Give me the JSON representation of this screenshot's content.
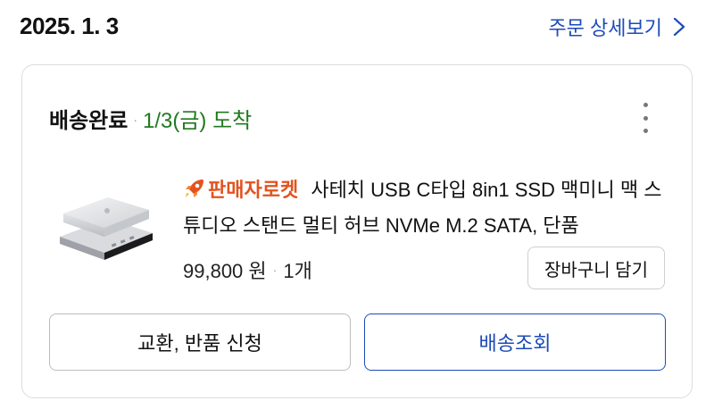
{
  "order": {
    "date": "2025. 1. 3",
    "detail_link_label": "주문 상세보기"
  },
  "status": {
    "main": "배송완료",
    "separator": "·",
    "arrival": "1/3(금) 도착"
  },
  "product": {
    "badge": "판매자로켓",
    "title": "사테치 USB C타입 8in1 SSD 맥미니 맥 스튜디오 스탠드 멀티 허브 NVMe M.2 SATA, 단품",
    "price": "99,800 원",
    "separator": "·",
    "quantity": "1개",
    "cart_button_label": "장바구니 담기"
  },
  "actions": {
    "exchange_return_label": "교환, 반품 신청",
    "tracking_label": "배송조회"
  },
  "icons": {
    "chevron": "chevron-right-icon",
    "more": "more-vertical-icon",
    "badge": "rocket-icon"
  },
  "colors": {
    "link_blue": "#1d4bb8",
    "arrival_green": "#1f7a1f",
    "badge_orange": "#e2531f"
  }
}
